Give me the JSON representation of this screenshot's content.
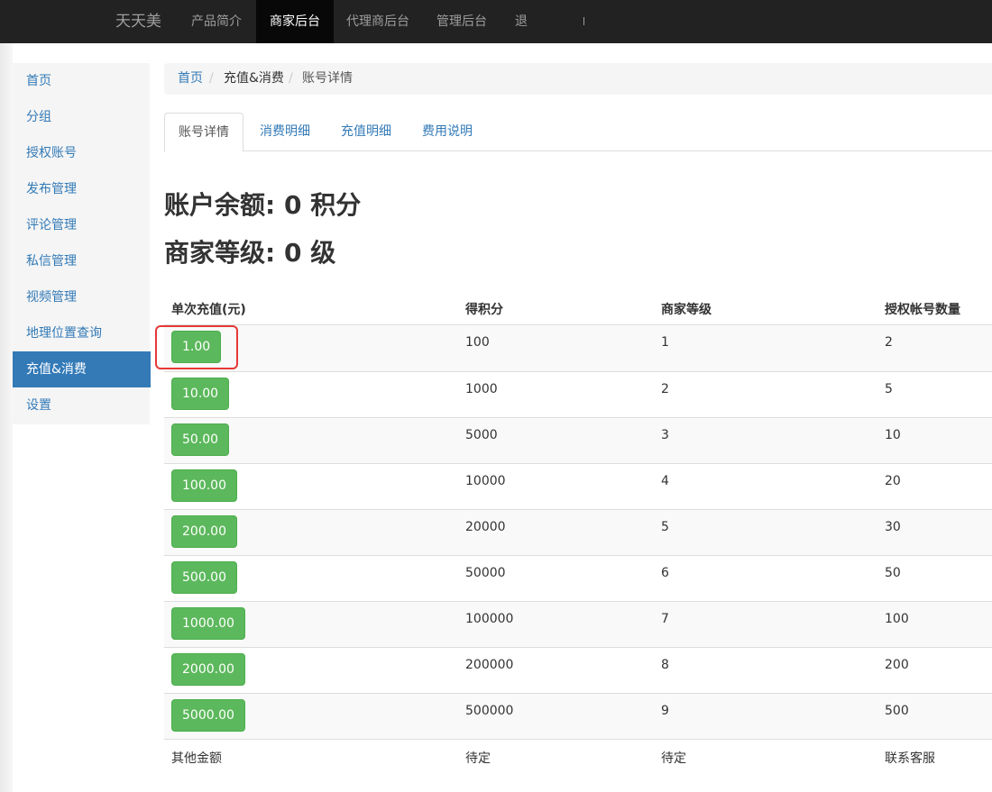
{
  "navbar": {
    "brand": "天天美",
    "items": [
      "产品简介",
      "商家后台",
      "代理商后台",
      "管理后台",
      "退"
    ],
    "active_index": 1
  },
  "sidebar": {
    "items": [
      "首页",
      "分组",
      "授权账号",
      "发布管理",
      "评论管理",
      "私信管理",
      "视频管理",
      "地理位置查询",
      "充值&消费",
      "设置"
    ],
    "active_index": 8
  },
  "breadcrumb": {
    "home": "首页",
    "section": "充值&消费",
    "current": "账号详情",
    "separator": "/"
  },
  "tabs": {
    "items": [
      "账号详情",
      "消费明细",
      "充值明细",
      "费用说明"
    ],
    "active_index": 0
  },
  "account": {
    "balance_label": "账户余额:",
    "balance_value": "0",
    "balance_unit": "积分",
    "level_label": "商家等级:",
    "level_value": "0",
    "level_unit": "级"
  },
  "table": {
    "headers": [
      "单次充值(元)",
      "得积分",
      "商家等级",
      "授权帐号数量"
    ],
    "rows": [
      [
        "1.00",
        "100",
        "1",
        "2"
      ],
      [
        "10.00",
        "1000",
        "2",
        "5"
      ],
      [
        "50.00",
        "5000",
        "3",
        "10"
      ],
      [
        "100.00",
        "10000",
        "4",
        "20"
      ],
      [
        "200.00",
        "20000",
        "5",
        "30"
      ],
      [
        "500.00",
        "50000",
        "6",
        "50"
      ],
      [
        "1000.00",
        "100000",
        "7",
        "100"
      ],
      [
        "2000.00",
        "200000",
        "8",
        "200"
      ],
      [
        "5000.00",
        "500000",
        "9",
        "500"
      ]
    ],
    "other_row": [
      "其他金额",
      "待定",
      "待定",
      "联系客服"
    ]
  },
  "colors": {
    "navbar_bg": "#222222",
    "link": "#337ab7",
    "success": "#5cb85c",
    "highlight": "#e53935"
  }
}
